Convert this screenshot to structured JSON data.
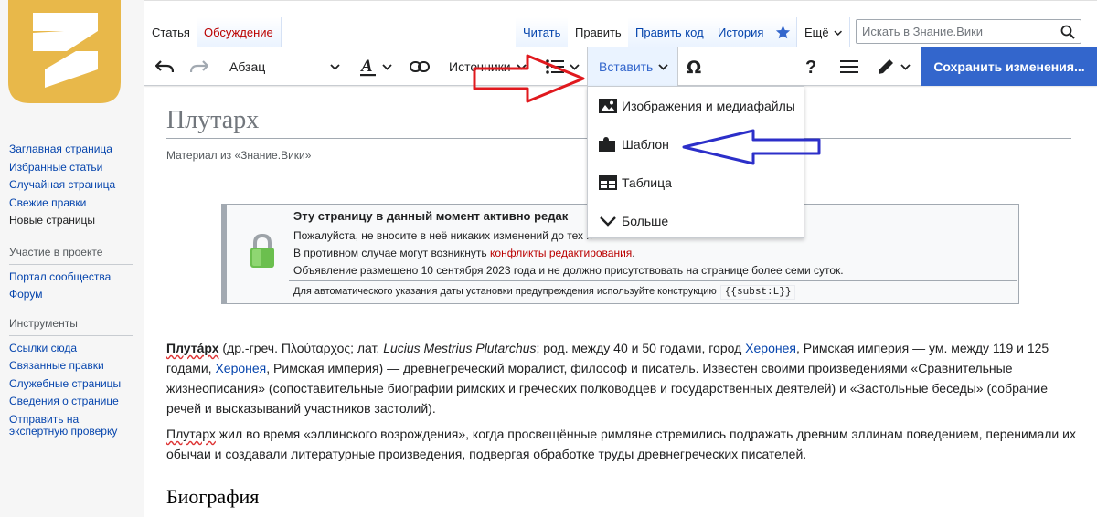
{
  "sidebar": {
    "nav_items": [
      {
        "label": "Заглавная страница",
        "visited": false
      },
      {
        "label": "Избранные статьи",
        "visited": false
      },
      {
        "label": "Случайная страница",
        "visited": false
      },
      {
        "label": "Свежие правки",
        "visited": false
      },
      {
        "label": "Новые страницы",
        "visited": true
      }
    ],
    "participation": {
      "heading": "Участие в проекте",
      "items": [
        "Портал сообщества",
        "Форум"
      ]
    },
    "tools": {
      "heading": "Инструменты",
      "items": [
        "Ссылки сюда",
        "Связанные правки",
        "Служебные страницы",
        "Сведения о странице",
        "Отправить на экспертную проверку"
      ]
    }
  },
  "tabs": {
    "left": [
      "Статья",
      "Обсуждение"
    ],
    "right": [
      "Читать",
      "Править",
      "Править код",
      "История"
    ],
    "more": "Ещё"
  },
  "search": {
    "placeholder": "Искать в Знание.Вики"
  },
  "toolbar": {
    "paragraph": "Абзац",
    "sources": "Источники",
    "insert": "Вставить",
    "save": "Сохранить изменения..."
  },
  "insert_menu": {
    "items": [
      "Изображения и медиафайлы",
      "Шаблон",
      "Таблица",
      "Больше"
    ]
  },
  "article": {
    "title": "Плутарх",
    "tagline": "Материал из «Знание.Вики»",
    "notice": {
      "heading": "Эту страницу в данный момент активно редак",
      "line1": "Пожалуйста, не вносите в неё никаких изменений до тех п",
      "line2_pre": "В противном случае могут возникнуть ",
      "line2_link": "конфликты редактирования",
      "line2_post": ".",
      "line3": "Объявление размещено 10 сентября 2023 года и не должно присутствовать на странице более семи суток.",
      "line4": "Для автоматического указания даты установки предупреждения используйте конструкцию",
      "code": "{{subst:L}}"
    },
    "p1": {
      "bold": "Плута́рх",
      "t1": " (др.-греч. Πλούταρχος; лат. ",
      "latin": "Lucius Mestrius Plutarchus",
      "t2": "; род. между 40 и 50 годами, город ",
      "link1": "Херонея",
      "t3": ", Римская империя — ум. между 119 и 125 годами, ",
      "link2": "Херонея",
      "t4": ", Римская империя) — древнегреческий моралист, философ и писатель. Известен своими произведениями «Сравнительные жизнеописания» (сопоставительные биографии римских и греческих полководцев и государственных деятелей) и «Застольные беседы» (собрание речей и высказываний участников застолий)."
    },
    "p2": {
      "name": "Плутарх",
      "text": " жил во время «эллинского возрождения», когда просвещённые римляне стремились подражать древним эллинам поведением, перенимали их обычаи и создавали литературные произведения, подвергая обработке труды древнегреческих писателей."
    },
    "section": "Биография"
  },
  "colors": {
    "link": "#0645ad",
    "accent": "#3366cc",
    "red_arrow": "#e0191e",
    "blue_arrow": "#2c2fc9",
    "logo": "#e8b84a"
  }
}
